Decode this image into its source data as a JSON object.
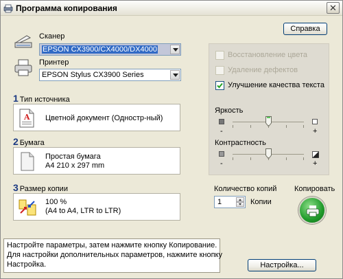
{
  "window": {
    "title": "Программа копирования",
    "close_glyph": "✕"
  },
  "help_button": "Справка",
  "scanner": {
    "label": "Сканер",
    "value": "EPSON CX3900/CX4000/DX4000"
  },
  "printer": {
    "label": "Принтер",
    "value": "EPSON Stylus CX3900 Series"
  },
  "source": {
    "number": "1",
    "label": "Тип источника",
    "value": "Цветной документ (Одностр-ный)"
  },
  "paper": {
    "number": "2",
    "label": "Бумага",
    "line1": "Простая бумага",
    "line2": "A4 210 x 297 mm"
  },
  "copy_size": {
    "number": "3",
    "label": "Размер копии",
    "line1": "100 %",
    "line2": "(A4 to A4, LTR to LTR)"
  },
  "options": {
    "color_restore": {
      "label": "Восстановление цвета",
      "checked": false,
      "enabled": false
    },
    "dust_removal": {
      "label": "Удаление дефектов",
      "checked": false,
      "enabled": false
    },
    "text_enhance": {
      "label": "Улучшение качества текста",
      "checked": true,
      "enabled": true
    }
  },
  "brightness": {
    "label": "Яркость",
    "minus": "-",
    "plus": "+",
    "level": 0.5
  },
  "contrast": {
    "label": "Контрастность",
    "minus": "-",
    "plus": "+",
    "level": 0.5
  },
  "copies": {
    "label": "Количество копий",
    "value": "1",
    "unit": "Копии"
  },
  "copy_button": {
    "label": "Копировать"
  },
  "status": {
    "line1": "Настройте параметры, затем нажмите кнопку Копирование.",
    "line2": "Для настройки дополнительных параметров, нажмите кнопку",
    "line3": "Настройка."
  },
  "settings_button": "Настройка...",
  "icons": {
    "title": "copy-app-icon",
    "scanner": "scanner-icon",
    "printer": "printer-icon",
    "source": "color-document-icon",
    "paper": "paper-icon",
    "copy_size": "resize-icon",
    "copy": "copy-printer-icon"
  }
}
